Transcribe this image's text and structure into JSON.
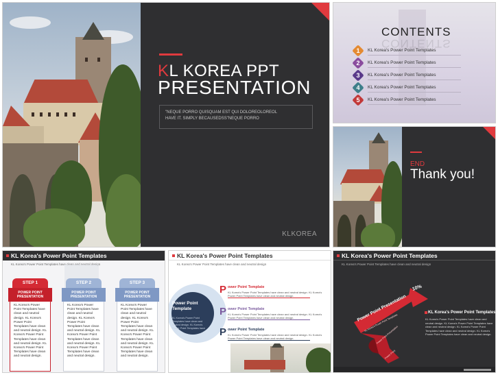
{
  "slide1": {
    "title_first_letter": "K",
    "title_rest": "L KOREA PPT",
    "title_line2": "PRESENTATION",
    "quote_line1": "\"NEQUE PORRO QUISQUAM EST QUI DOLOREOLOREOL",
    "quote_line2": "HAVE IT. SIMPLY BECAUSEDSS\"NEQUE PORRO",
    "brand": "KLKOREA"
  },
  "slide2": {
    "title": "CONTENTS",
    "items": [
      {
        "num": "1",
        "label": "KL Korea's Power Point Templates",
        "color": "#e48a32"
      },
      {
        "num": "2",
        "label": "KL Korea's Power Point Templates",
        "color": "#8a4c9e"
      },
      {
        "num": "3",
        "label": "KL Korea's Power Point Templates",
        "color": "#5a3a8a"
      },
      {
        "num": "4",
        "label": "KL Korea's Power Point Templates",
        "color": "#3e7f8a"
      },
      {
        "num": "5",
        "label": "KL Korea's Power Point Templates",
        "color": "#c23a3a"
      }
    ]
  },
  "slide3": {
    "end": "END",
    "thanks": "Thank you!"
  },
  "slide4": {
    "header": "KL Korea's Power Point Templates",
    "sub": "KL Korea's Power Point Templates have clean and neutral design",
    "steps": [
      {
        "step": "STEP 1",
        "head": "POWER POINT PRESENTATION",
        "body": "KL Korea's Power Point Templates have clean and neutral design. KL Korea's Power Point Templates have clean and neutral design. KL Korea's Power Point Templates have clean and neutral design. KL Korea's Power Point Templates have clean and neutral design."
      },
      {
        "step": "STEP 2",
        "head": "POWER POINT PRESENTATION",
        "body": "KL Korea's Power Point Templates have clean and neutral design. KL Korea's Power Point Templates have clean and neutral design. KL Korea's Power Point Templates have clean and neutral design. KL Korea's Power Point Templates have clean and neutral design."
      },
      {
        "step": "STEP 3",
        "head": "POWER POINT PRESENTATION",
        "body": "KL Korea's Power Point Templates have clean and neutral design. KL Korea's Power Point Templates have clean and neutral design. KL Korea's Power Point Templates have clean and neutral design. KL Korea's Power Point Templates have clean and neutral design."
      }
    ]
  },
  "slide5": {
    "header": "KL Korea's Power Point Templates",
    "sub": "KL Korea's Power Point Templates have clean and neutral design",
    "circle_title": "Power Point Template",
    "circle_text": "KL Korea's Power Point Templates have clean and neutral design. KL Korea's Power Point Templates have",
    "items": [
      {
        "letter": "P",
        "title": "ower Point Template",
        "text": "KL Korea's Power Point Templates have clean and neutral design. KL Korea's Power Point Templates have clean and neutral design.",
        "color": "#d42a34"
      },
      {
        "letter": "P",
        "title": "ower Point Template",
        "text": "KL Korea's Power Point Templates have clean and neutral design. KL Korea's Power Point Templates have clean and neutral design.",
        "color": "#7a5a9e"
      },
      {
        "letter": "P",
        "title": "ower Point Template",
        "text": "KL Korea's Power Point Templates have clean and neutral design. KL Korea's Power Point Templates have clean and neutral design.",
        "color": "#2c3e5b"
      }
    ]
  },
  "slide6": {
    "header": "KL Korea's Power Point Templates",
    "sub": "KL Korea's Power Point Templates have clean and neutral design",
    "ribbon_text": "Power Point Presentation",
    "ribbon_pct": "10%",
    "ribbon_sub": "KL Korea's Power Point Templates",
    "ribbon_sub2": "Power Point Presentation",
    "ribbon_sub3": "Power Point",
    "right_title": "KL Korea's Power Point Templates",
    "right_text": "KL Korea's Power Point Templates have clean and neutral design. KL Korea's Power Point Templates have clean and neutral design. KL Korea's Power Point Templates have clean and neutral design. KL Korea's Power Point Templates have clean and neutral design."
  }
}
